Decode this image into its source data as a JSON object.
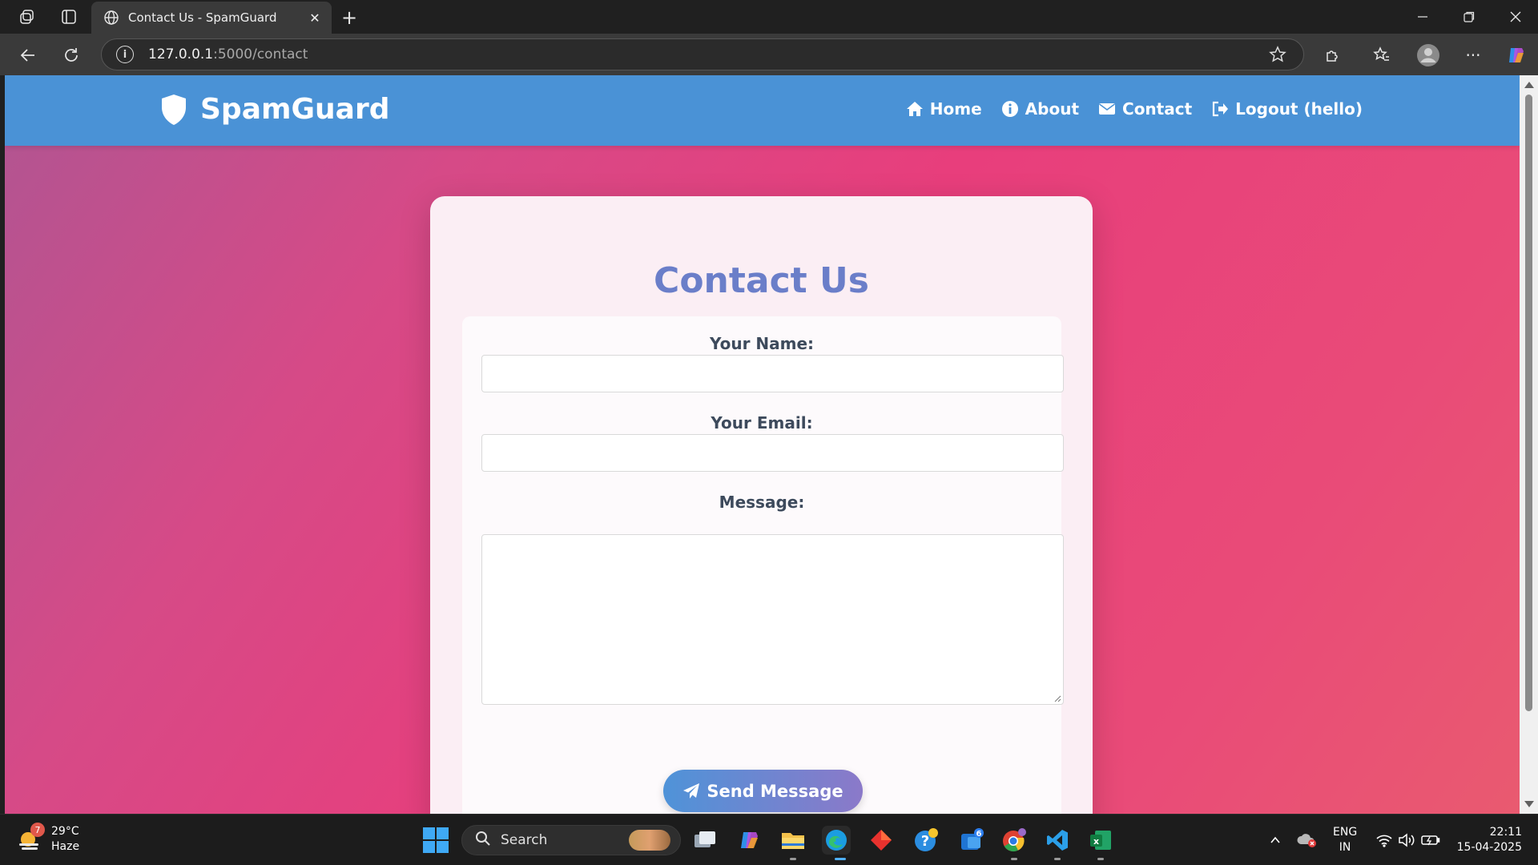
{
  "browser": {
    "tab_title": "Contact Us - SpamGuard",
    "url_host": "127.0.0.1",
    "url_path": ":5000/contact"
  },
  "site": {
    "brand": "SpamGuard",
    "nav": [
      {
        "label": "Home",
        "icon": "home-icon"
      },
      {
        "label": "About",
        "icon": "info-icon"
      },
      {
        "label": "Contact",
        "icon": "envelope-icon"
      },
      {
        "label": "Logout (hello)",
        "icon": "logout-icon"
      }
    ],
    "colors": {
      "header": "#4a92d6",
      "title": "#6a7ec9",
      "button_start": "#4f93d8",
      "button_end": "#8b79c9"
    }
  },
  "form": {
    "title": "Contact Us",
    "name_label": "Your Name:",
    "email_label": "Your Email:",
    "message_label": "Message:",
    "submit_label": "Send Message"
  },
  "taskbar": {
    "weather_temp": "29°C",
    "weather_desc": "Haze",
    "weather_badge": "7",
    "search_placeholder": "Search",
    "outlook_badge": "6",
    "lang_top": "ENG",
    "lang_bottom": "IN",
    "time": "22:11",
    "date": "15-04-2025"
  }
}
